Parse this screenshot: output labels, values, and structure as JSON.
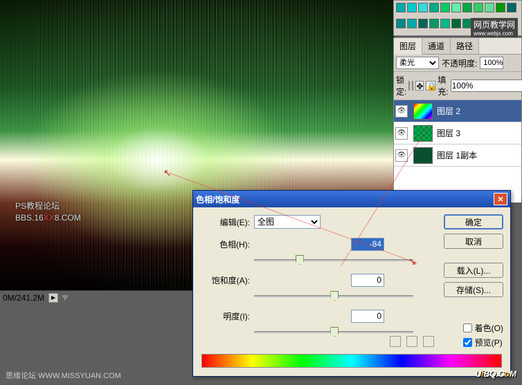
{
  "watermark": {
    "line1": "PS教程论坛",
    "line2a": "BBS.16",
    "line2b": "XX",
    "line2c": "8.COM"
  },
  "swatch_label": "网页教学网",
  "swatch_url": "www.webjx.com",
  "status": "0M/241.2M",
  "layers": {
    "tabs": [
      "图层",
      "通道",
      "路径"
    ],
    "blend_label": "",
    "blend": "柔光",
    "opacity_label": "不透明度:",
    "opacity": "100%",
    "lock_label": "锁定:",
    "fill_label": "填充:",
    "fill": "100%",
    "items": [
      {
        "name": "图层 2",
        "selected": true,
        "thumb_grad": "linear-gradient(135deg,#f00,#ff0,#0f0,#0ff,#00f,#f0f)"
      },
      {
        "name": "图层 3",
        "selected": false,
        "thumb_grad": "repeating-conic-gradient(#0a5 0 25%,#083 0 50%)"
      },
      {
        "name": "图层 1副本",
        "selected": false,
        "thumb_grad": "#0a5030"
      }
    ]
  },
  "dialog": {
    "title": "色相/饱和度",
    "edit_label": "编辑(E):",
    "edit_value": "全图",
    "hue_label": "色相(H):",
    "hue_value": "-84",
    "sat_label": "饱和度(A):",
    "sat_value": "0",
    "light_label": "明度(I):",
    "light_value": "0",
    "ok": "确定",
    "cancel": "取消",
    "load": "载入(L)...",
    "save": "存储(S)...",
    "colorize": "着色(O)",
    "preview": "预览(P)"
  },
  "footer": {
    "left": "思缘论坛  WWW.MISSYUAN.COM",
    "right_u": "U",
    "right_i": "i",
    "right_b": "BQ.C",
    "right_o": "o",
    "right_m": "M"
  }
}
